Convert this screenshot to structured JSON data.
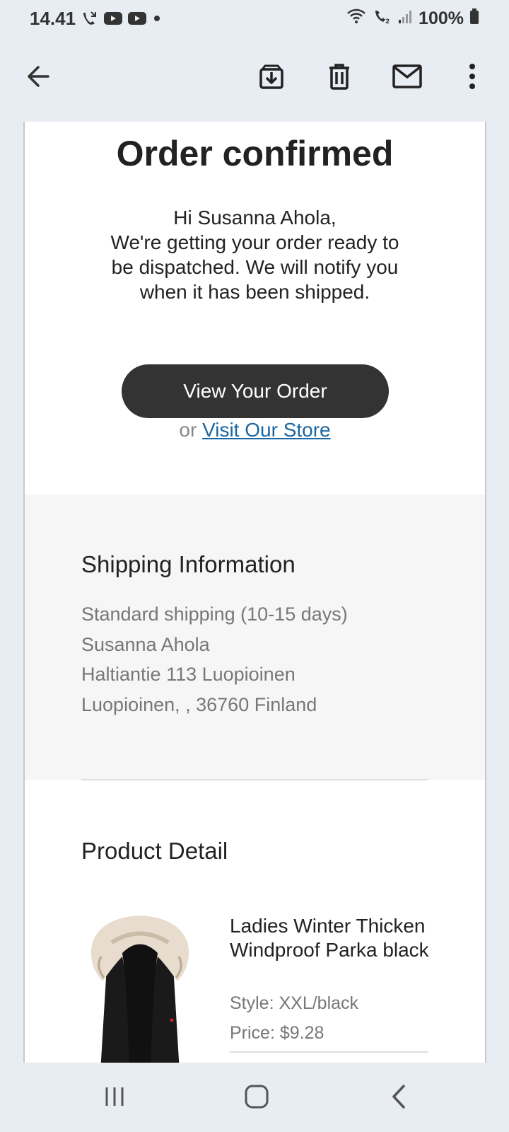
{
  "status": {
    "time": "14.41",
    "battery": "100%"
  },
  "toolbar": {
    "back_icon": "arrow-left-icon",
    "archive_icon": "archive-icon",
    "delete_icon": "trash-icon",
    "mail_icon": "mail-icon",
    "more_icon": "more-vert-icon"
  },
  "email": {
    "title": "Order confirmed",
    "greeting": "Hi Susanna Ahola,",
    "message_lines": [
      "We're getting your order ready to",
      "be dispatched. We will notify you",
      "when it has been shipped."
    ],
    "view_order_label": "View Your Order",
    "or_text": "or",
    "visit_store_label": "Visit Our Store"
  },
  "shipping": {
    "heading": "Shipping Information",
    "method": "Standard shipping (10-15 days)",
    "name": "Susanna Ahola",
    "address1": "Haltiantie 113 Luopioinen",
    "address2": "Luopioinen, , 36760 Finland"
  },
  "product": {
    "heading": "Product Detail",
    "name": "Ladies Winter Thicken Windproof Parka black",
    "style": "Style: XXL/black",
    "price": "Price: $9.28"
  },
  "colors": {
    "button_dark": "#333333",
    "link": "#1a67a3",
    "chrome": "#e8edf4"
  }
}
